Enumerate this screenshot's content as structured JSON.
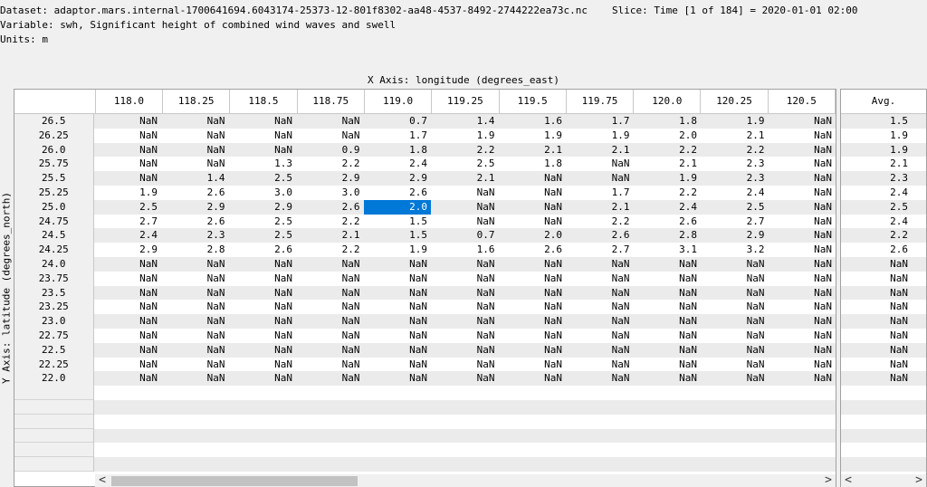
{
  "info": {
    "dataset": "Dataset: adaptor.mars.internal-1700641694.6043174-25373-12-801f8302-aa48-4537-8492-2744222ea73c.nc",
    "variable": "Variable: swh, Significant height of combined wind waves and swell",
    "units": "Units: m",
    "slice": "Slice: Time [1 of 184] = 2020-01-01 02:00"
  },
  "x_axis_title": "X Axis: longitude (degrees_east)",
  "y_axis_title": "Y Axis: latitude (degrees_north)",
  "columns": [
    "118.0",
    "118.25",
    "118.5",
    "118.75",
    "119.0",
    "119.25",
    "119.5",
    "119.75",
    "120.0",
    "120.25",
    "120.5"
  ],
  "avg_header": "Avg.",
  "rows": [
    {
      "lat": "26.5",
      "values": [
        "NaN",
        "NaN",
        "NaN",
        "NaN",
        "0.7",
        "1.4",
        "1.6",
        "1.7",
        "1.8",
        "1.9",
        "NaN"
      ],
      "avg": "1.5"
    },
    {
      "lat": "26.25",
      "values": [
        "NaN",
        "NaN",
        "NaN",
        "NaN",
        "1.7",
        "1.9",
        "1.9",
        "1.9",
        "2.0",
        "2.1",
        "NaN"
      ],
      "avg": "1.9"
    },
    {
      "lat": "26.0",
      "values": [
        "NaN",
        "NaN",
        "NaN",
        "0.9",
        "1.8",
        "2.2",
        "2.1",
        "2.1",
        "2.2",
        "2.2",
        "NaN"
      ],
      "avg": "1.9"
    },
    {
      "lat": "25.75",
      "values": [
        "NaN",
        "NaN",
        "1.3",
        "2.2",
        "2.4",
        "2.5",
        "1.8",
        "NaN",
        "2.1",
        "2.3",
        "NaN"
      ],
      "avg": "2.1"
    },
    {
      "lat": "25.5",
      "values": [
        "NaN",
        "1.4",
        "2.5",
        "2.9",
        "2.9",
        "2.1",
        "NaN",
        "NaN",
        "1.9",
        "2.3",
        "NaN"
      ],
      "avg": "2.3"
    },
    {
      "lat": "25.25",
      "values": [
        "1.9",
        "2.6",
        "3.0",
        "3.0",
        "2.6",
        "NaN",
        "NaN",
        "1.7",
        "2.2",
        "2.4",
        "NaN"
      ],
      "avg": "2.4"
    },
    {
      "lat": "25.0",
      "values": [
        "2.5",
        "2.9",
        "2.9",
        "2.6",
        "2.0",
        "NaN",
        "NaN",
        "2.1",
        "2.4",
        "2.5",
        "NaN"
      ],
      "avg": "2.5"
    },
    {
      "lat": "24.75",
      "values": [
        "2.7",
        "2.6",
        "2.5",
        "2.2",
        "1.5",
        "NaN",
        "NaN",
        "2.2",
        "2.6",
        "2.7",
        "NaN"
      ],
      "avg": "2.4"
    },
    {
      "lat": "24.5",
      "values": [
        "2.4",
        "2.3",
        "2.5",
        "2.1",
        "1.5",
        "0.7",
        "2.0",
        "2.6",
        "2.8",
        "2.9",
        "NaN"
      ],
      "avg": "2.2"
    },
    {
      "lat": "24.25",
      "values": [
        "2.9",
        "2.8",
        "2.6",
        "2.2",
        "1.9",
        "1.6",
        "2.6",
        "2.7",
        "3.1",
        "3.2",
        "NaN"
      ],
      "avg": "2.6"
    },
    {
      "lat": "24.0",
      "values": [
        "NaN",
        "NaN",
        "NaN",
        "NaN",
        "NaN",
        "NaN",
        "NaN",
        "NaN",
        "NaN",
        "NaN",
        "NaN"
      ],
      "avg": "NaN"
    },
    {
      "lat": "23.75",
      "values": [
        "NaN",
        "NaN",
        "NaN",
        "NaN",
        "NaN",
        "NaN",
        "NaN",
        "NaN",
        "NaN",
        "NaN",
        "NaN"
      ],
      "avg": "NaN"
    },
    {
      "lat": "23.5",
      "values": [
        "NaN",
        "NaN",
        "NaN",
        "NaN",
        "NaN",
        "NaN",
        "NaN",
        "NaN",
        "NaN",
        "NaN",
        "NaN"
      ],
      "avg": "NaN"
    },
    {
      "lat": "23.25",
      "values": [
        "NaN",
        "NaN",
        "NaN",
        "NaN",
        "NaN",
        "NaN",
        "NaN",
        "NaN",
        "NaN",
        "NaN",
        "NaN"
      ],
      "avg": "NaN"
    },
    {
      "lat": "23.0",
      "values": [
        "NaN",
        "NaN",
        "NaN",
        "NaN",
        "NaN",
        "NaN",
        "NaN",
        "NaN",
        "NaN",
        "NaN",
        "NaN"
      ],
      "avg": "NaN"
    },
    {
      "lat": "22.75",
      "values": [
        "NaN",
        "NaN",
        "NaN",
        "NaN",
        "NaN",
        "NaN",
        "NaN",
        "NaN",
        "NaN",
        "NaN",
        "NaN"
      ],
      "avg": "NaN"
    },
    {
      "lat": "22.5",
      "values": [
        "NaN",
        "NaN",
        "NaN",
        "NaN",
        "NaN",
        "NaN",
        "NaN",
        "NaN",
        "NaN",
        "NaN",
        "NaN"
      ],
      "avg": "NaN"
    },
    {
      "lat": "22.25",
      "values": [
        "NaN",
        "NaN",
        "NaN",
        "NaN",
        "NaN",
        "NaN",
        "NaN",
        "NaN",
        "NaN",
        "NaN",
        "NaN"
      ],
      "avg": "NaN"
    },
    {
      "lat": "22.0",
      "values": [
        "NaN",
        "NaN",
        "NaN",
        "NaN",
        "NaN",
        "NaN",
        "NaN",
        "NaN",
        "NaN",
        "NaN",
        "NaN"
      ],
      "avg": "NaN"
    }
  ],
  "empty_rows": 6,
  "selected_cell": {
    "row": 6,
    "col": 4
  },
  "scrollbar": {
    "left_arrow": "<",
    "right_arrow": ">"
  },
  "colors": {
    "selection": "#0078d7",
    "stripe": "#ebebeb"
  }
}
